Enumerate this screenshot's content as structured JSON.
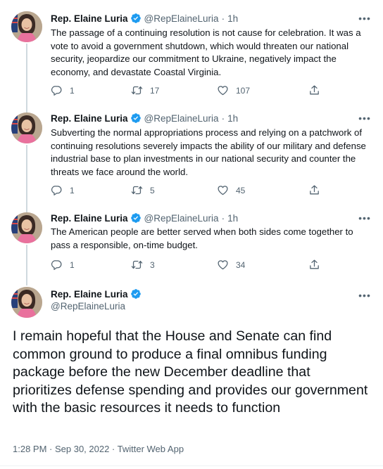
{
  "author": {
    "name": "Rep. Elaine Luria",
    "handle": "@RepElaineLuria"
  },
  "colors": {
    "verified_badge": "#1d9bf0",
    "muted_text": "#536471",
    "thread_line": "#cfd9de"
  },
  "icons": {
    "reply": "reply-icon",
    "retweet": "retweet-icon",
    "like": "heart-icon",
    "share": "share-icon",
    "more": "more-icon",
    "verified": "verified-badge-icon"
  },
  "tweets": [
    {
      "separator": "·",
      "time": "1h",
      "text": "The passage of a continuing resolution is not cause for celebration. It was a vote to avoid a government shutdown, which would threaten our national security, jeopardize our commitment to Ukraine, negatively impact the economy, and devastate Coastal Virginia.",
      "replies": "1",
      "retweets": "17",
      "likes": "107"
    },
    {
      "separator": "·",
      "time": "1h",
      "text": "Subverting the normal appropriations process and relying on a patchwork of continuing resolutions severely impacts the ability of our military and defense industrial base to plan investments in our national security and counter the threats we face around the world.",
      "replies": "1",
      "retweets": "5",
      "likes": "45"
    },
    {
      "separator": "·",
      "time": "1h",
      "text": "The American people are better served when both sides come together to pass a responsible, on-time budget.",
      "replies": "1",
      "retweets": "3",
      "likes": "34"
    }
  ],
  "main_tweet": {
    "text": "I remain hopeful that the House and Senate can find common ground to produce a final omnibus funding package before the new December deadline that prioritizes defense spending and provides our government with the basic resources it needs to function",
    "meta": "1:28 PM · Sep 30, 2022 · Twitter Web App"
  }
}
